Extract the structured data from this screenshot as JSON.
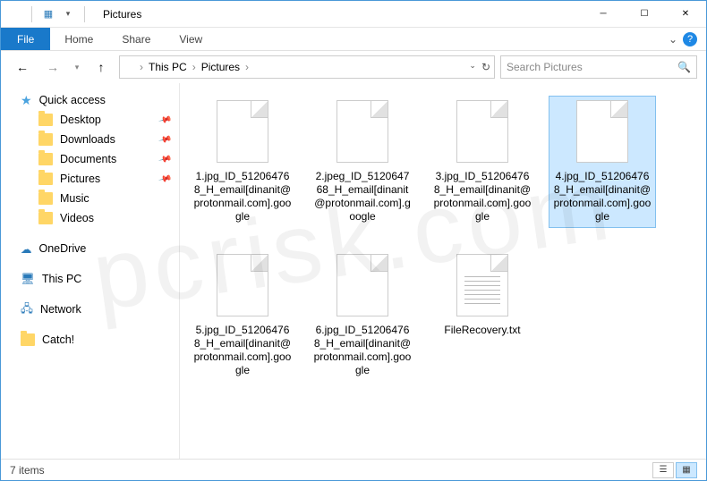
{
  "titlebar": {
    "title": "Pictures"
  },
  "win_controls": {
    "min": "─",
    "max": "☐",
    "close": "✕"
  },
  "ribbon": {
    "file": "File",
    "tabs": [
      "Home",
      "Share",
      "View"
    ]
  },
  "nav_buttons": {
    "back": "←",
    "fwd": "→",
    "up": "↑"
  },
  "breadcrumb": {
    "root": "This PC",
    "folder": "Pictures"
  },
  "search": {
    "placeholder": "Search Pictures"
  },
  "sidebar": {
    "quick_access": "Quick access",
    "items": [
      {
        "label": "Desktop",
        "pinned": true
      },
      {
        "label": "Downloads",
        "pinned": true
      },
      {
        "label": "Documents",
        "pinned": true
      },
      {
        "label": "Pictures",
        "pinned": true
      },
      {
        "label": "Music",
        "pinned": false
      },
      {
        "label": "Videos",
        "pinned": false
      }
    ],
    "onedrive": "OneDrive",
    "this_pc": "This PC",
    "network": "Network",
    "catch": "Catch!"
  },
  "files": [
    {
      "name": "1.jpg_ID_512064768_H_email[dinanit@protonmail.com].google",
      "type": "blank",
      "selected": false
    },
    {
      "name": "2.jpeg_ID_512064768_H_email[dinanit@protonmail.com].google",
      "type": "blank",
      "selected": false
    },
    {
      "name": "3.jpg_ID_512064768_H_email[dinanit@protonmail.com].google",
      "type": "blank",
      "selected": false
    },
    {
      "name": "4.jpg_ID_512064768_H_email[dinanit@protonmail.com].google",
      "type": "blank",
      "selected": true
    },
    {
      "name": "5.jpg_ID_512064768_H_email[dinanit@protonmail.com].google",
      "type": "blank",
      "selected": false
    },
    {
      "name": "6.jpg_ID_512064768_H_email[dinanit@protonmail.com].google",
      "type": "blank",
      "selected": false
    },
    {
      "name": "FileRecovery.txt",
      "type": "text",
      "selected": false
    }
  ],
  "status": {
    "count": "7 items"
  },
  "watermark": "pcrisk.com"
}
